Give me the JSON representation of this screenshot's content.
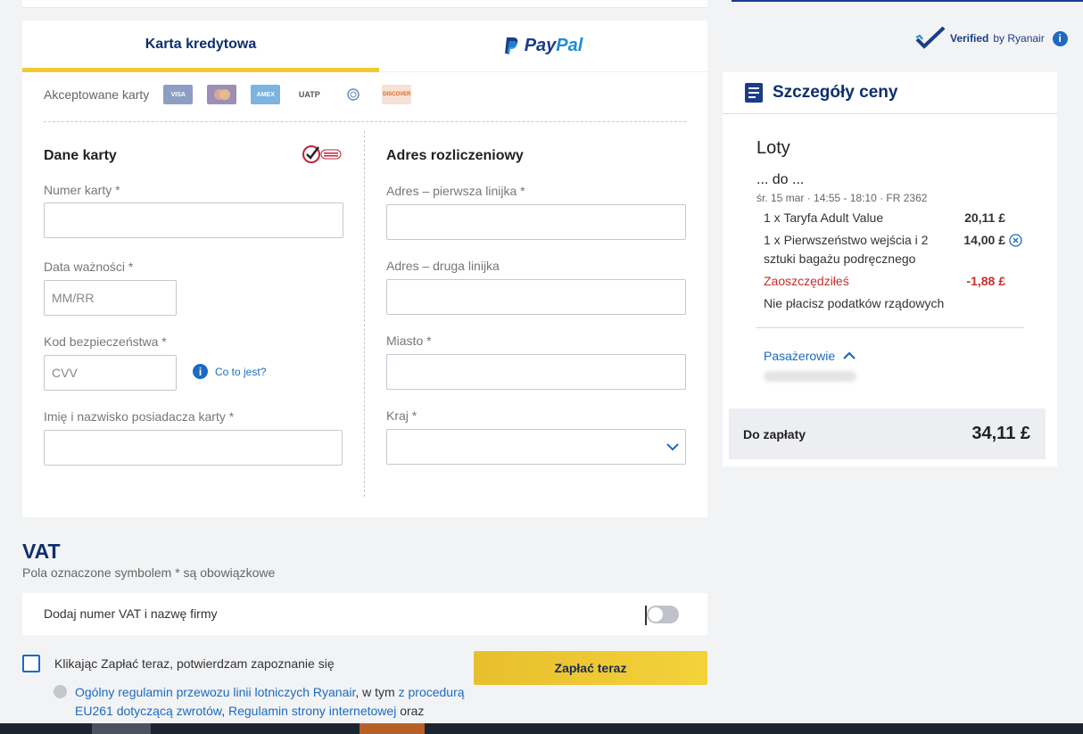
{
  "payment_tabs": {
    "credit_card": "Karta kredytowa",
    "paypal_pay": "Pay",
    "paypal_pal": "Pal"
  },
  "accepted_cards": {
    "label": "Akceptowane karty",
    "logos": [
      "VISA",
      "mastercard",
      "AMERICAN EXPRESS",
      "UATP",
      "Diners Club",
      "DISCOVER"
    ]
  },
  "card_details": {
    "title": "Dane karty",
    "card_number_label": "Numer karty *",
    "expiry_label": "Data ważności *",
    "expiry_placeholder": "MM/RR",
    "security_code_label": "Kod bezpieczeństwa *",
    "security_code_placeholder": "CVV",
    "what_is_it": "Co to jest?",
    "holder_label": "Imię i nazwisko posiadacza karty *",
    "badge_text": "Verified Secured"
  },
  "billing": {
    "title": "Adres rozliczeniowy",
    "line1_label": "Adres – pierwsza linijka *",
    "line2_label": "Adres – druga linijka",
    "city_label": "Miasto *",
    "country_label": "Kraj *"
  },
  "verified": {
    "bold": "Verified",
    "rest": "by Ryanair"
  },
  "price": {
    "title": "Szczegóły ceny",
    "section": "Loty",
    "route": "... do ...",
    "flight_info": "śr. 15 mar  ·  14:55 - 18:10  ·  FR 2362",
    "items": [
      {
        "label": "1 x Taryfa Adult Value",
        "amount": "20,11 £"
      },
      {
        "label_line1": "1 x Pierwszeństwo wejścia i 2",
        "label_line2": "sztuki bagażu podręcznego",
        "amount": "14,00 £"
      },
      {
        "label": "Zaoszczędziłeś",
        "amount": "-1,88 £"
      }
    ],
    "no_taxes": "Nie płacisz podatków rządowych",
    "passengers": "Pasażerowie",
    "total_label": "Do zapłaty",
    "total_value": "34,11 £"
  },
  "vat": {
    "title": "VAT",
    "note": "Pola oznaczone symbolem * są obowiązkowe",
    "toggle_label": "Dodaj numer VAT i nazwę firmy",
    "toggle_on": false
  },
  "confirm": {
    "checkbox_label": "Klikając Zapłać teraz, potwierdzam zapoznanie się",
    "pay_button": "Zapłać teraz",
    "terms_1": "Ogólny regulamin przewozu linii lotniczych Ryanair",
    "terms_2": ", w tym ",
    "terms_3": "z procedurą EU261 dotyczącą zwrotów",
    "terms_4": ", ",
    "terms_5": "Regulamin strony internetowej",
    "terms_6": " oraz"
  }
}
